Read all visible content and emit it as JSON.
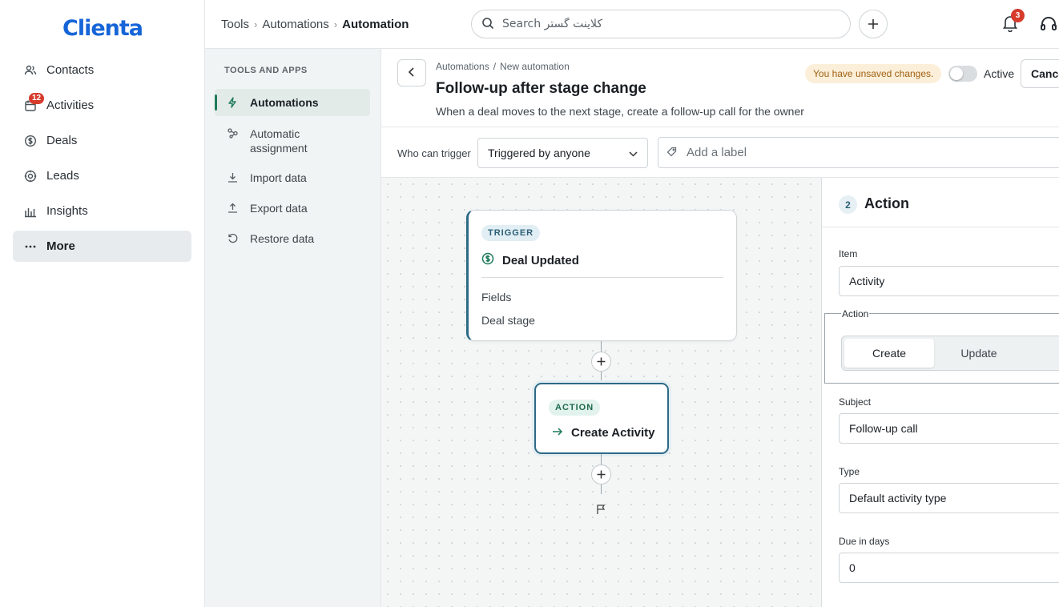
{
  "app": {
    "logo": "Clienta"
  },
  "nav": {
    "items": [
      {
        "label": "Contacts",
        "icon": "contacts-icon"
      },
      {
        "label": "Activities",
        "icon": "calendar-icon",
        "badge": "12"
      },
      {
        "label": "Deals",
        "icon": "deals-icon"
      },
      {
        "label": "Leads",
        "icon": "leads-icon"
      },
      {
        "label": "Insights",
        "icon": "insights-icon"
      },
      {
        "label": "More",
        "icon": "more-icon",
        "active": true
      }
    ]
  },
  "topbar": {
    "breadcrumb": [
      "Tools",
      "Automations",
      "Automation"
    ],
    "search_placeholder": "Search کلاینت گستر",
    "notifications_count": "3"
  },
  "tools": {
    "title": "TOOLS AND APPS",
    "items": [
      {
        "label": "Automations",
        "icon": "bolt-icon",
        "active": true
      },
      {
        "label": "Automatic assignment",
        "icon": "assignment-icon"
      },
      {
        "label": "Import data",
        "icon": "download-icon"
      },
      {
        "label": "Export data",
        "icon": "upload-icon"
      },
      {
        "label": "Restore data",
        "icon": "restore-icon"
      }
    ]
  },
  "automation": {
    "crumb_parent": "Automations",
    "crumb_current": "New automation",
    "title": "Follow-up after stage change",
    "description": "When a deal moves to the next stage, create a follow-up call for the owner",
    "unsaved": "You have unsaved changes.",
    "active_label": "Active",
    "active": false,
    "cancel_label": "Cancel"
  },
  "trigger_bar": {
    "who_label": "Who can trigger",
    "who_value": "Triggered by anyone",
    "label_placeholder": "Add a label"
  },
  "flow": {
    "trigger": {
      "tag": "TRIGGER",
      "title": "Deal Updated",
      "fields_label": "Fields",
      "field": "Deal stage"
    },
    "action": {
      "tag": "ACTION",
      "title": "Create Activity"
    }
  },
  "panel": {
    "step": "2",
    "title": "Action",
    "item_label": "Item",
    "item_value": "Activity",
    "action_label": "Action",
    "action_options": [
      "Create",
      "Update"
    ],
    "action_selected": "Create",
    "subject_label": "Subject",
    "subject_value": "Follow-up call",
    "type_label": "Type",
    "type_value": "Default activity type",
    "due_label": "Due in days",
    "due_value": "0"
  },
  "colors": {
    "brand": "#1565d8",
    "accent": "#1f7a5a",
    "badge": "#d63b2c",
    "trigger_border": "#2d6a86",
    "unsaved_bg": "#fcefd9"
  }
}
